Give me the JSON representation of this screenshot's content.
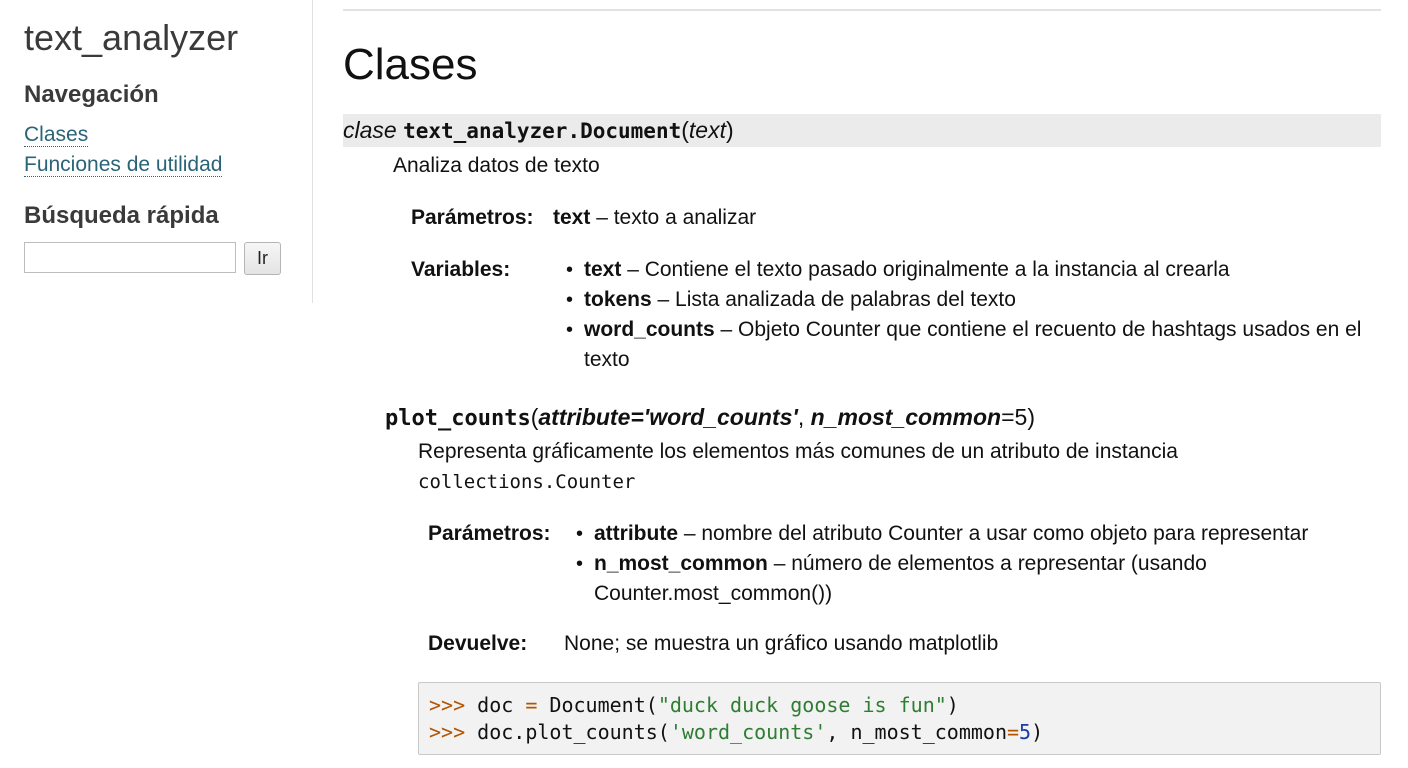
{
  "sidebar": {
    "project_title": "text_analyzer",
    "nav_heading": "Navegación",
    "nav_items": [
      {
        "label": "Clases"
      },
      {
        "label": "Funciones de utilidad"
      }
    ],
    "search_heading": "Búsqueda rápida",
    "search_value": "",
    "search_button": "Ir"
  },
  "main": {
    "page_title": "Clases",
    "class_sig": {
      "keyword": "clase",
      "name": "text_analyzer.Document",
      "open_paren": "(",
      "param": "text",
      "close_paren": ")"
    },
    "class_desc": "Analiza datos de texto",
    "params": {
      "label": "Parámetros:",
      "name": "text",
      "desc": " – texto a analizar"
    },
    "variables": {
      "label": "Variables:",
      "items": [
        {
          "name": "text",
          "desc": " – Contiene el texto pasado originalmente a la instancia al crearla"
        },
        {
          "name": "tokens",
          "desc": " – Lista analizada de palabras del texto"
        },
        {
          "name": "word_counts",
          "desc": " – Objeto Counter que contiene el recuento de hashtags usados en el",
          "desc_cont": "texto"
        }
      ]
    },
    "method": {
      "name": "plot_counts",
      "open_paren": "(",
      "arg1": "attribute='word_counts'",
      "comma": ", ",
      "arg2": "n_most_common",
      "arg2_default": "=5",
      "close_paren": ")",
      "desc_line1": "Representa gráficamente los elementos más comunes de un atributo de instancia",
      "desc_code": "collections.Counter",
      "params_label": "Parámetros:",
      "params": [
        {
          "name": "attribute",
          "desc": " – nombre del atributo Counter a usar como objeto para representar"
        },
        {
          "name": "n_most_common",
          "desc": " – número de elementos a representar (usando",
          "desc_cont": "Counter.most_common())"
        }
      ],
      "returns_label": "Devuelve:",
      "returns": "None; se muestra un gráfico usando matplotlib"
    },
    "code_example": {
      "line1": {
        "prompt": ">>>",
        "a": " doc ",
        "op": "=",
        "b": " Document(",
        "str": "\"duck duck goose is fun\"",
        "c": ")"
      },
      "line2": {
        "prompt": ">>>",
        "a": " doc.plot_counts(",
        "str": "'word_counts'",
        "b": ", n_most_common",
        "op": "=",
        "num": "5",
        "c": ")"
      }
    }
  }
}
